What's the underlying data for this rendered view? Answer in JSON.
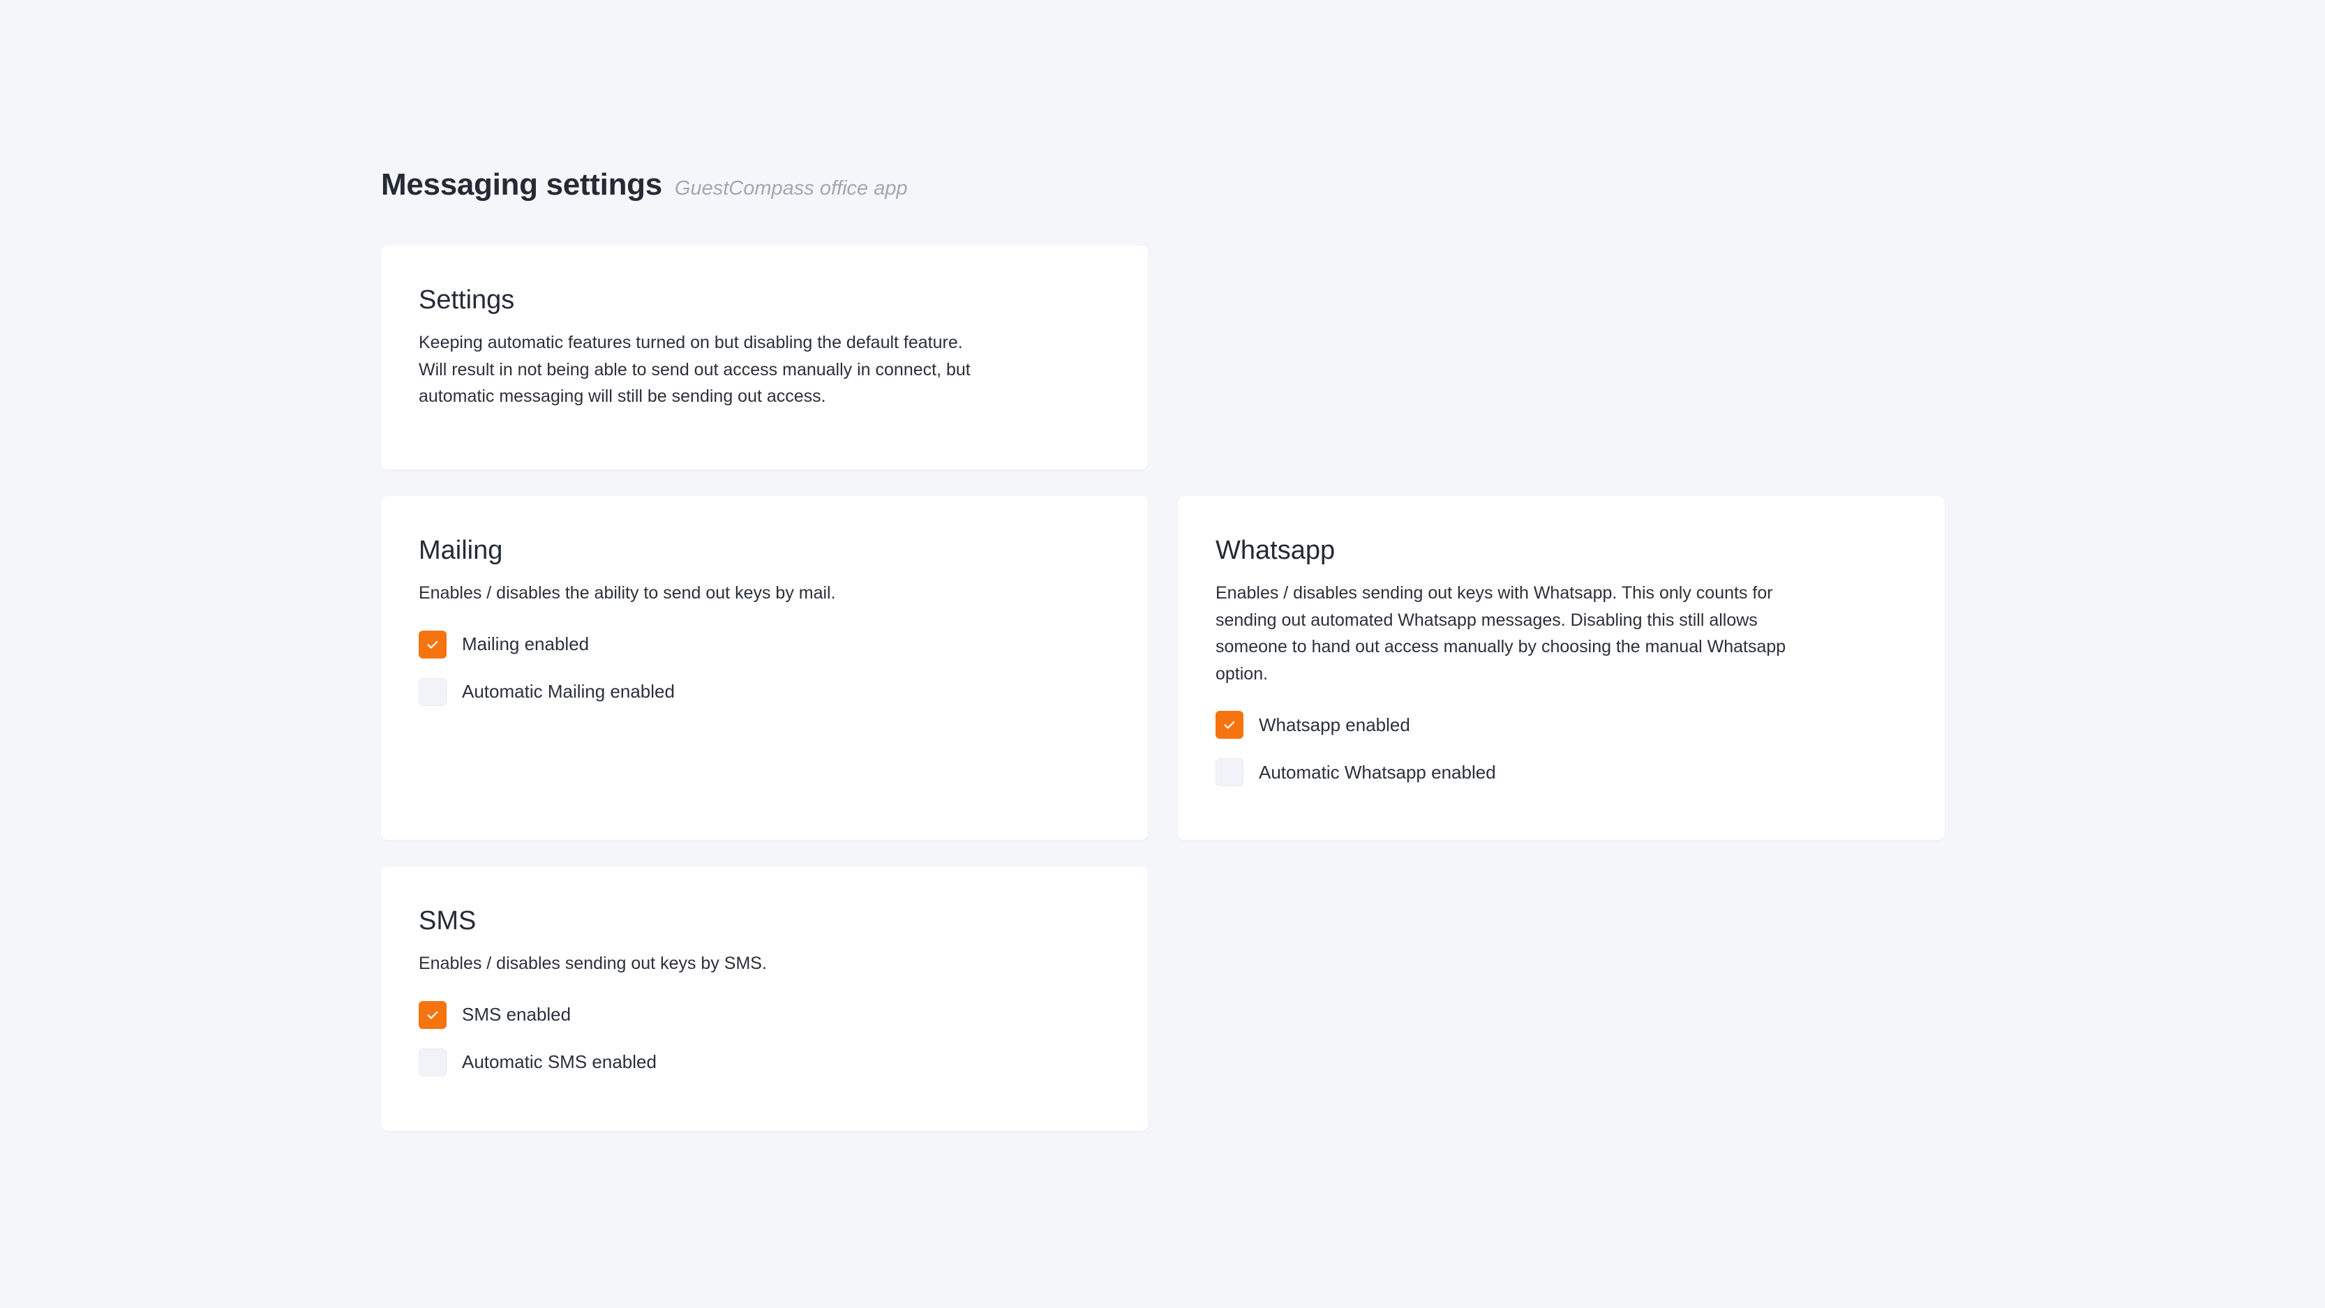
{
  "header": {
    "title": "Messaging settings",
    "subtitle": "GuestCompass office app"
  },
  "cards": {
    "settings": {
      "title": "Settings",
      "description": "Keeping automatic features turned on but disabling the default feature. Will result in not being able to send out access manually in connect, but automatic messaging will still be sending out access."
    },
    "mailing": {
      "title": "Mailing",
      "description": "Enables / disables the ability to send out keys by mail.",
      "options": [
        {
          "label": "Mailing enabled",
          "checked": true
        },
        {
          "label": "Automatic Mailing enabled",
          "checked": false
        }
      ]
    },
    "whatsapp": {
      "title": "Whatsapp",
      "description": "Enables / disables sending out keys with Whatsapp. This only counts for sending out automated Whatsapp messages. Disabling this still allows someone to hand out access manually by choosing the manual Whatsapp option.",
      "options": [
        {
          "label": "Whatsapp enabled",
          "checked": true
        },
        {
          "label": "Automatic Whatsapp enabled",
          "checked": false
        }
      ]
    },
    "sms": {
      "title": "SMS",
      "description": "Enables / disables sending out keys by SMS.",
      "options": [
        {
          "label": "SMS enabled",
          "checked": true
        },
        {
          "label": "Automatic SMS enabled",
          "checked": false
        }
      ]
    }
  },
  "icons": {
    "checkbox_check": "check-icon"
  },
  "colors": {
    "accent": "#f57410",
    "background": "#f5f6fa",
    "card": "#ffffff",
    "unchecked_box": "#f2f3f8",
    "subtitle": "#a3a7b1"
  }
}
